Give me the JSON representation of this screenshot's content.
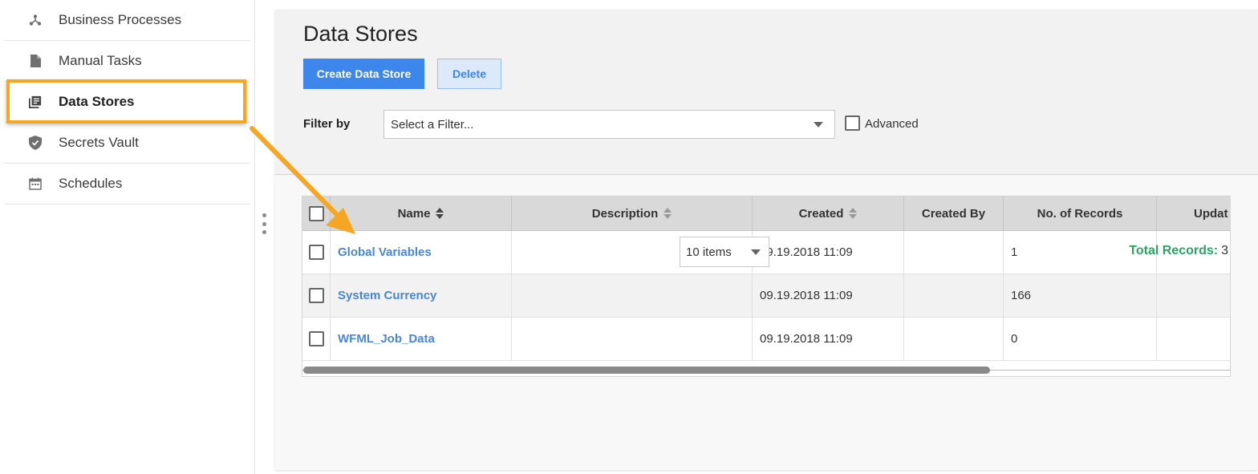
{
  "sidebar": {
    "items": [
      {
        "label": "Business Processes",
        "icon": "process-icon"
      },
      {
        "label": "Manual Tasks",
        "icon": "document-icon"
      },
      {
        "label": "Data Stores",
        "icon": "datastore-icon",
        "active": true
      },
      {
        "label": "Secrets Vault",
        "icon": "shield-icon"
      },
      {
        "label": "Schedules",
        "icon": "calendar-icon"
      }
    ]
  },
  "page": {
    "title": "Data Stores",
    "create_label": "Create Data Store",
    "delete_label": "Delete"
  },
  "filter": {
    "label": "Filter by",
    "placeholder": "Select a Filter...",
    "advanced_label": "Advanced"
  },
  "table": {
    "columns": [
      "Name",
      "Description",
      "Created",
      "Created By",
      "No. of Records",
      "Updat"
    ],
    "rows": [
      {
        "name": "Global Variables",
        "description": "",
        "created": "09.19.2018 11:09",
        "created_by": "",
        "records": "1",
        "updated": ""
      },
      {
        "name": "System Currency",
        "description": "",
        "created": "09.19.2018 11:09",
        "created_by": "",
        "records": "166",
        "updated": ""
      },
      {
        "name": "WFML_Job_Data",
        "description": "",
        "created": "09.19.2018 11:09",
        "created_by": "",
        "records": "0",
        "updated": ""
      }
    ]
  },
  "pager": {
    "page_size_label": "10 items"
  },
  "totals": {
    "label": "Total Records:",
    "value": "3"
  },
  "colors": {
    "primary": "#3d86ec",
    "highlight": "#f5a623",
    "link": "#4a86d4",
    "total_label": "#2aa564"
  }
}
